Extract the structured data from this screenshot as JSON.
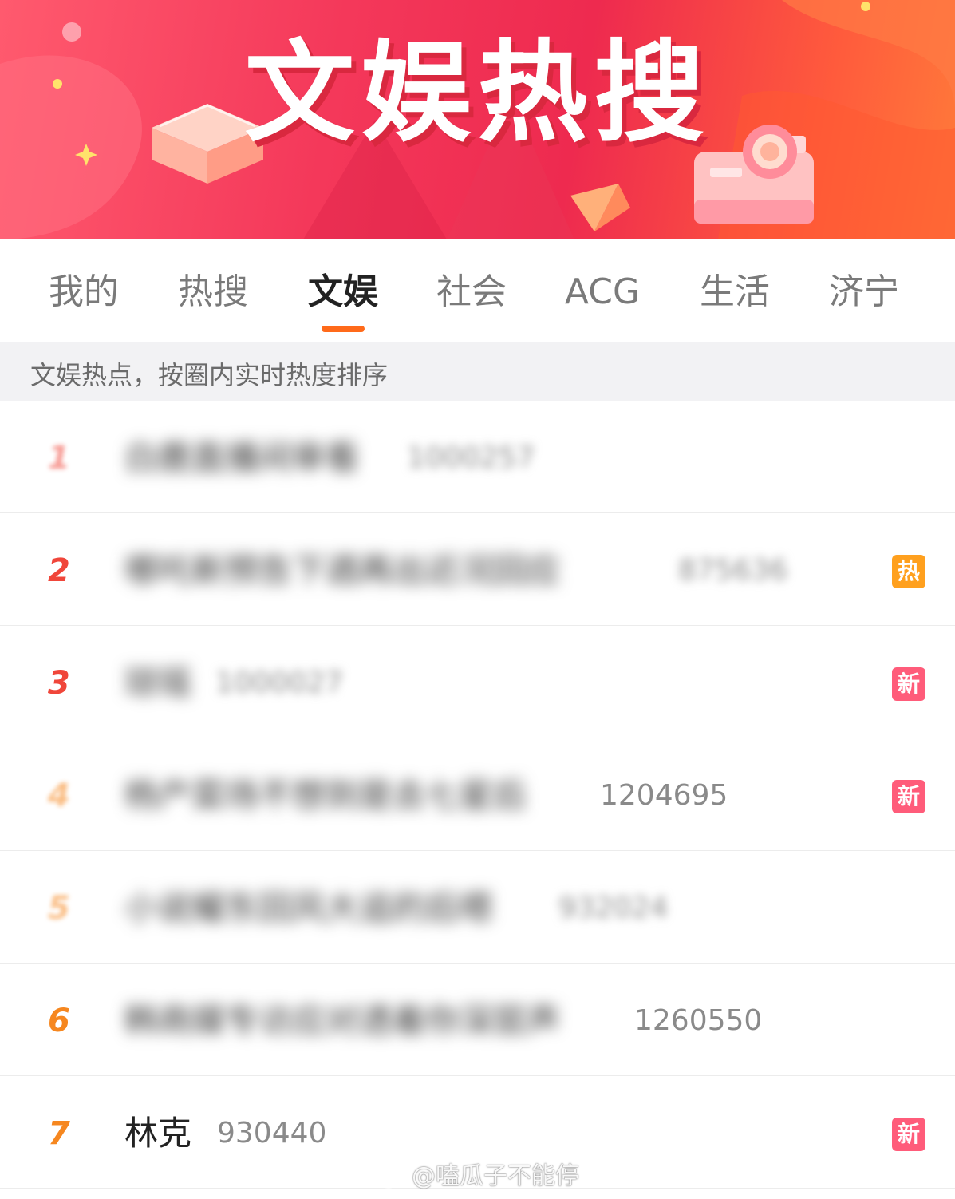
{
  "banner": {
    "title": "文娱热搜"
  },
  "tabs": [
    {
      "label": "我的",
      "active": false
    },
    {
      "label": "热搜",
      "active": false
    },
    {
      "label": "文娱",
      "active": true
    },
    {
      "label": "社会",
      "active": false
    },
    {
      "label": "ACG",
      "active": false
    },
    {
      "label": "生活",
      "active": false
    },
    {
      "label": "济宁",
      "active": false
    }
  ],
  "subtitle": "文娱热点，按圈内实时热度排序",
  "list": [
    {
      "rank": "1",
      "title": "白鹿直播间审看",
      "count": "1000257",
      "badge": ""
    },
    {
      "rank": "2",
      "title": "哪吒新预告下週再出近况回应",
      "count": "875636",
      "badge": "热"
    },
    {
      "rank": "3",
      "title": "琼瑶",
      "count": "1000027",
      "badge": "新"
    },
    {
      "rank": "4",
      "title": "杨产菜场不想到是去七星后",
      "count": "1204695",
      "badge": "新"
    },
    {
      "rank": "5",
      "title": "小说耀东回风大追的后嗯",
      "count": "932024",
      "badge": ""
    },
    {
      "rank": "6",
      "title": "韩商媒专访应对透着你深层声",
      "count": "1260550",
      "badge": ""
    },
    {
      "rank": "7",
      "title": "林克",
      "count": "930440",
      "badge": "新"
    }
  ],
  "watermark": "@嗑瓜子不能停",
  "colors": {
    "accent": "#ff6a1a",
    "rank_top": "#f0463a",
    "rank_rest": "#f6871f",
    "badge_hot": "#ffa01e",
    "badge_new": "#ff5c7a",
    "banner_red": "#ee2a4f"
  }
}
